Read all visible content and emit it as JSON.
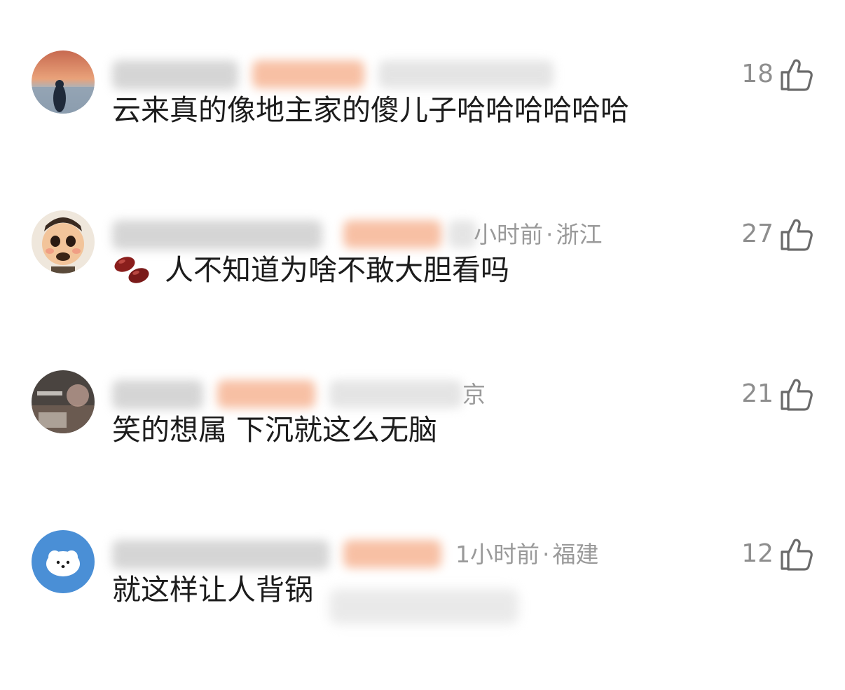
{
  "comments": [
    {
      "meta": "",
      "text": "云来真的像地主家的傻儿子哈哈哈哈哈哈",
      "likes": "18"
    },
    {
      "meta_time": "小时前",
      "meta_region": "浙江",
      "text": "人不知道为啥不敢大胆看吗",
      "emoji": "kidney-beans-emoji",
      "likes": "27"
    },
    {
      "meta": "京",
      "text": "笑的想属 下沉就这么无脑",
      "likes": "21"
    },
    {
      "meta_time": "1小时前",
      "meta_region": "福建",
      "text": "就这样让人背锅",
      "likes": "12"
    }
  ],
  "icons": {
    "like": "thumbs-up-icon"
  },
  "colors": {
    "background": "#ffffff",
    "text": "#1c1c1c",
    "meta": "#9a9a9a",
    "like_count": "#8e8e8e"
  }
}
